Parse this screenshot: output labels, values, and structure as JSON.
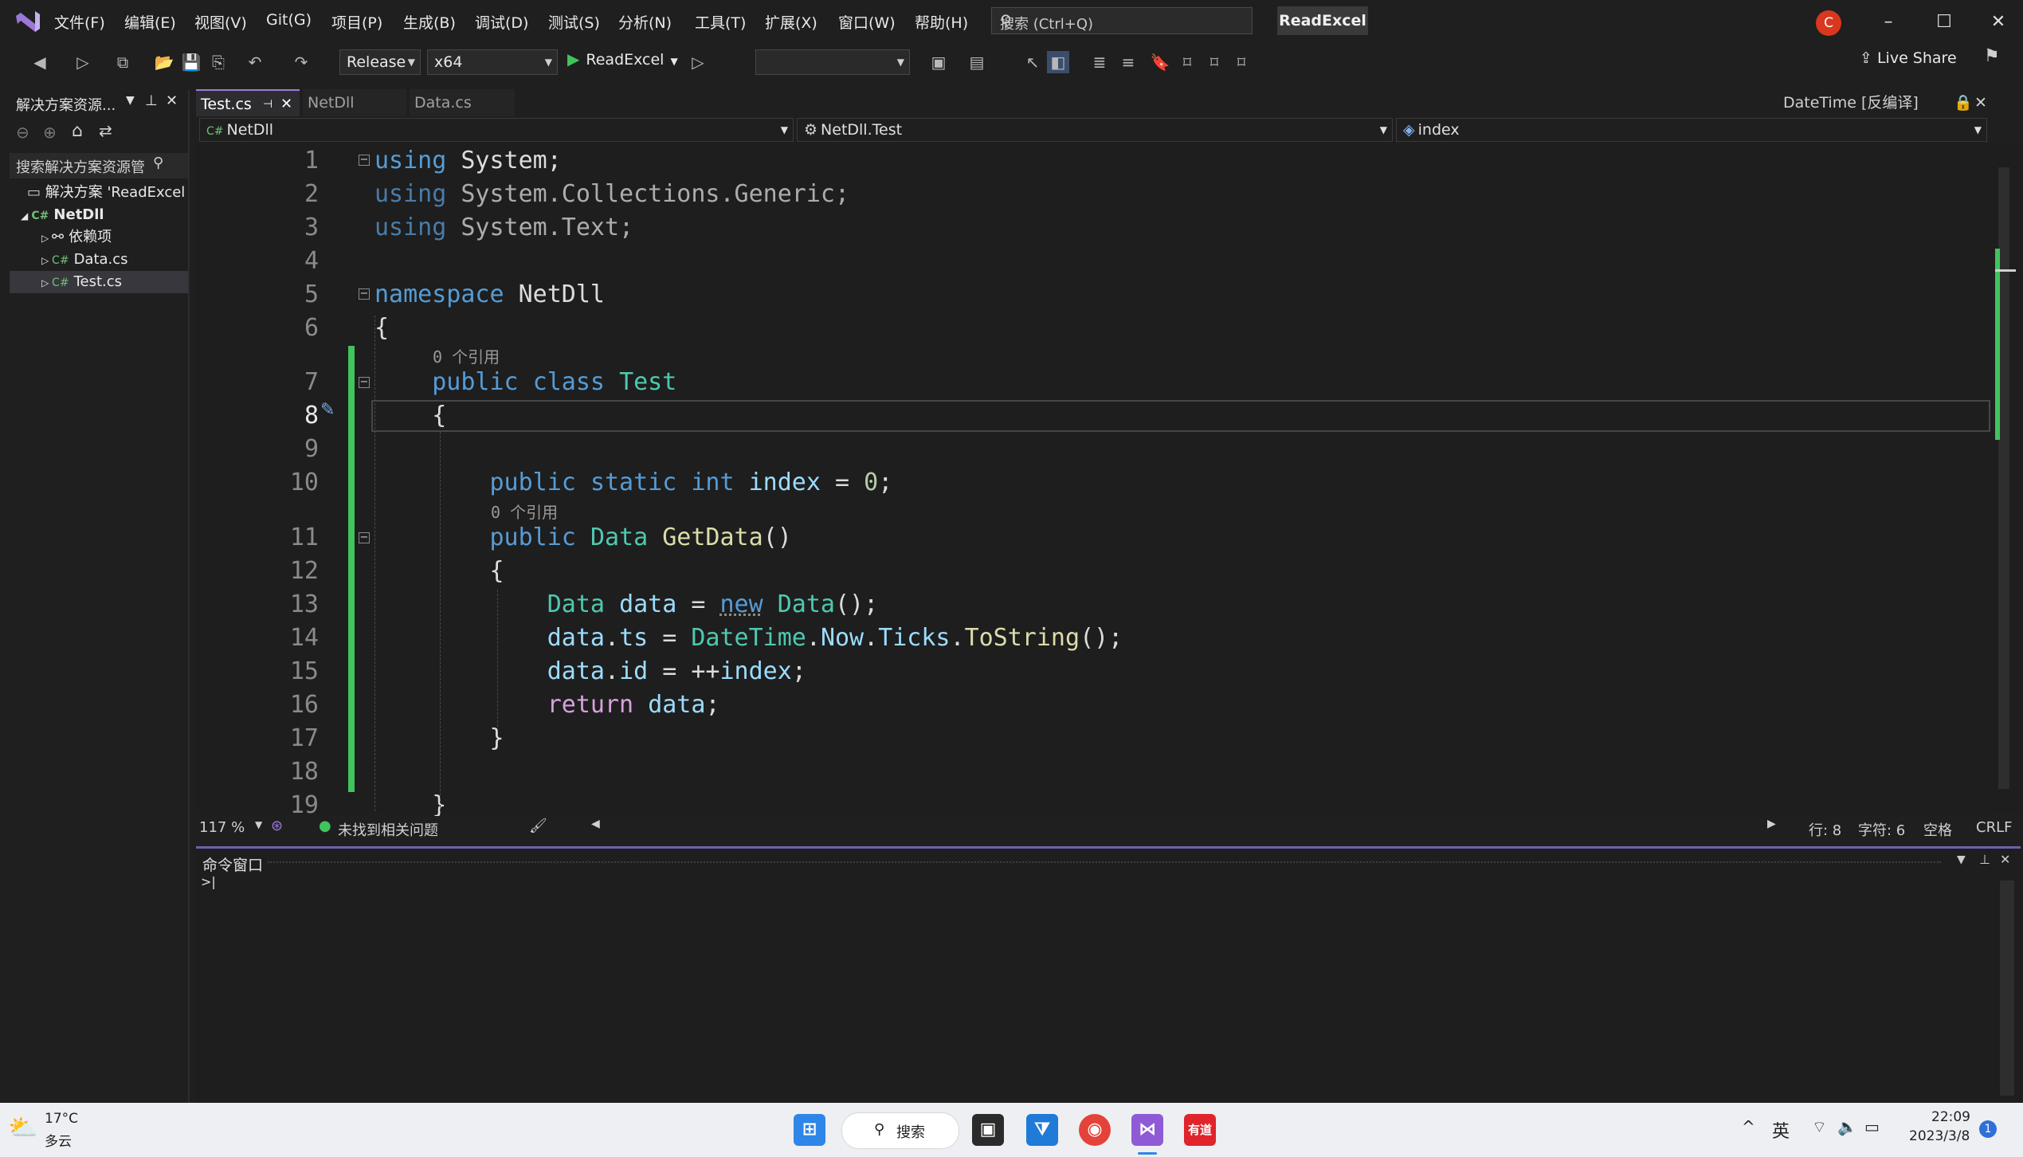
{
  "menu": {
    "items": [
      "文件(F)",
      "编辑(E)",
      "视图(V)",
      "Git(G)",
      "项目(P)",
      "生成(B)",
      "调试(D)",
      "测试(S)",
      "分析(N)",
      "工具(T)",
      "扩展(X)",
      "窗口(W)",
      "帮助(H)"
    ],
    "search_placeholder": "搜索 (Ctrl+Q)",
    "solution_name": "ReadExcel",
    "avatar_letter": "C"
  },
  "toolbar": {
    "configuration": "Release",
    "platform": "x64",
    "run_target": "ReadExcel",
    "live_share": "Live Share"
  },
  "solution_explorer": {
    "title": "解决方案资源...",
    "search_placeholder": "搜索解决方案资源管",
    "items": [
      {
        "label": "解决方案 'ReadExcel",
        "icon": "solution-icon"
      },
      {
        "label": "NetDll",
        "icon": "csharp-project-icon"
      },
      {
        "label": "依赖项",
        "icon": "dependencies-icon"
      },
      {
        "label": "Data.cs",
        "icon": "csharp-file-icon"
      },
      {
        "label": "Test.cs",
        "icon": "csharp-file-icon"
      }
    ]
  },
  "editor": {
    "tabs": [
      {
        "label": "Test.cs",
        "active": true
      },
      {
        "label": "NetDll",
        "active": false
      },
      {
        "label": "Data.cs",
        "active": false
      }
    ],
    "right_tab": "DateTime [反编译]",
    "nav": {
      "project": "NetDll",
      "type": "NetDll.Test",
      "member": "index"
    },
    "codelens_label": "0 个引用",
    "codelens_label_2": "0 个引用",
    "line_numbers": [
      "1",
      "2",
      "3",
      "4",
      "5",
      "6",
      "7",
      "8",
      "9",
      "10",
      "11",
      "12",
      "13",
      "14",
      "15",
      "16",
      "17",
      "18",
      "19"
    ],
    "current_line": "8"
  },
  "status": {
    "zoom": "117 %",
    "issues": "未找到相关问题",
    "line": "行: 8",
    "char": "字符: 6",
    "whitespace": "空格",
    "eol": "CRLF"
  },
  "command_window": {
    "title": "命令窗口",
    "prompt": ">|"
  },
  "taskbar": {
    "weather_temp": "17°C",
    "weather_desc": "多云",
    "search_label": "搜索",
    "ime": "英",
    "time": "22:09",
    "date": "2023/3/8",
    "notification_count": "1"
  },
  "colors": {
    "accent": "#9d7bd8",
    "change_bar": "#41c35d",
    "keyword": "#569cd6",
    "type": "#4ec9b0"
  }
}
